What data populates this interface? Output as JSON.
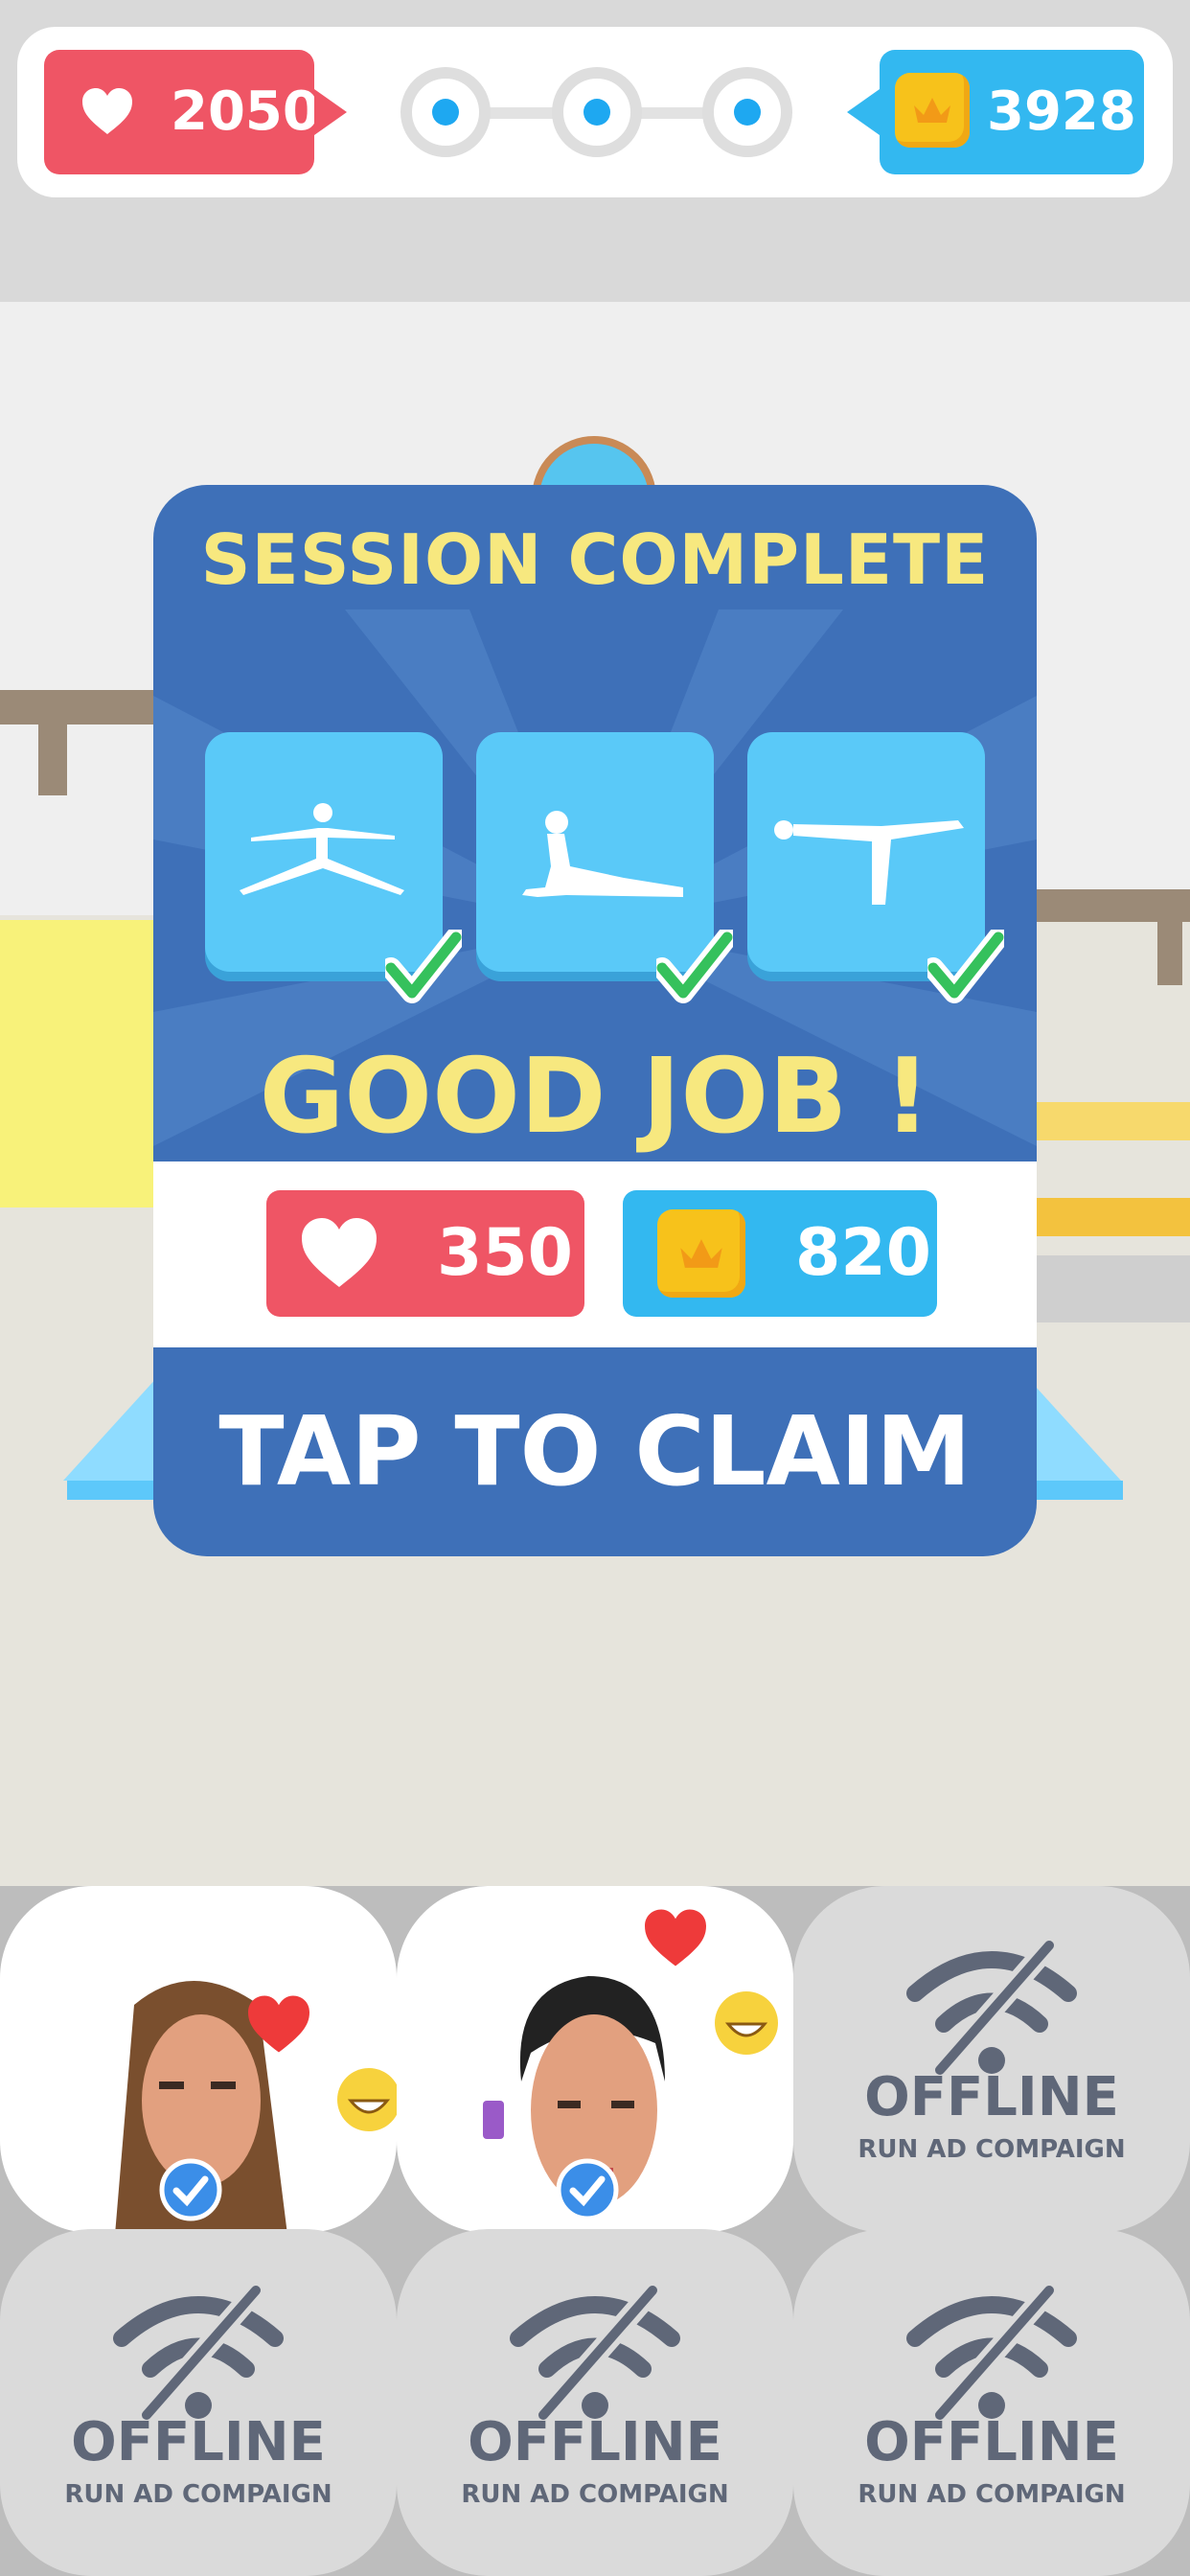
{
  "hud": {
    "hearts": "2050",
    "coins": "3928",
    "progress_steps": 3
  },
  "popup": {
    "title": "SESSION COMPLETE",
    "poses": [
      "split-jump-pose-icon",
      "cobra-pose-icon",
      "warrior-three-pose-icon"
    ],
    "message": "GOOD JOB !",
    "reward_hearts": "350",
    "reward_coins": "820",
    "claim_label": "TAP TO CLAIM"
  },
  "campaigns": [
    {
      "status": "active"
    },
    {
      "status": "active"
    },
    {
      "title": "OFFLINE",
      "subtitle": "RUN AD COMPAIGN"
    },
    {
      "title": "OFFLINE",
      "subtitle": "RUN AD COMPAIGN"
    },
    {
      "title": "OFFLINE",
      "subtitle": "RUN AD COMPAIGN"
    },
    {
      "title": "OFFLINE",
      "subtitle": "RUN AD COMPAIGN"
    }
  ],
  "colors": {
    "heart_red": "#ef5565",
    "coin_blue": "#33b8f0",
    "popup_blue": "#3e70b8",
    "title_yellow": "#f7e87f",
    "check_green": "#35c15c"
  }
}
